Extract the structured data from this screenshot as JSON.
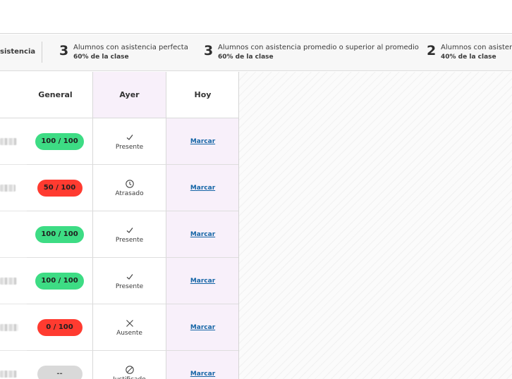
{
  "summary": {
    "cut_label": "sistencia",
    "stats": [
      {
        "number": "3",
        "line1": "Alumnos con asistencia perfecta",
        "line2": "60% de la clase"
      },
      {
        "number": "3",
        "line1": "Alumnos con asistencia promedio o superior al promedio",
        "line2": "60% de la clase"
      },
      {
        "number": "2",
        "line1": "Alumnos con asistencia",
        "line2": "40% de la clase"
      }
    ]
  },
  "table": {
    "headers": {
      "general": "General",
      "yesterday": "Ayer",
      "today": "Hoy"
    },
    "rows": [
      {
        "score": "100 / 100",
        "score_color": "#3ddc84",
        "yesterday_icon": "check-icon",
        "yesterday": "Presente",
        "today": "Marcar"
      },
      {
        "score": "50 / 100",
        "score_color": "#ff3b30",
        "yesterday_icon": "clock-icon",
        "yesterday": "Atrasado",
        "today": "Marcar"
      },
      {
        "score": "100 / 100",
        "score_color": "#3ddc84",
        "yesterday_icon": "check-icon",
        "yesterday": "Presente",
        "today": "Marcar"
      },
      {
        "score": "100 / 100",
        "score_color": "#3ddc84",
        "yesterday_icon": "check-icon",
        "yesterday": "Presente",
        "today": "Marcar"
      },
      {
        "score": "0 / 100",
        "score_color": "#ff3b30",
        "yesterday_icon": "x-icon",
        "yesterday": "Ausente",
        "today": "Marcar"
      },
      {
        "score": "--",
        "score_color": "#d9d9d9",
        "yesterday_icon": "no-entry-icon",
        "yesterday": "Justificado",
        "today": "Marcar"
      }
    ]
  },
  "colors": {
    "present": "#3ddc84",
    "absent": "#ff3b30",
    "today_column": "#f8f0fa",
    "link": "#1565a6"
  }
}
